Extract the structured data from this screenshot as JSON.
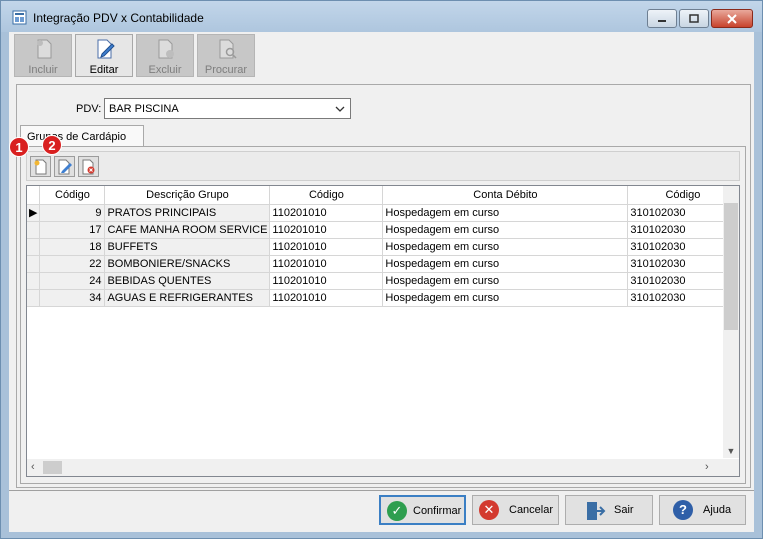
{
  "window": {
    "title": "Integração PDV x Contabilidade"
  },
  "toolbar": {
    "incluir": "Incluir",
    "editar": "Editar",
    "excluir": "Excluir",
    "procurar": "Procurar"
  },
  "pdv": {
    "label": "PDV:",
    "value": "BAR PISCINA"
  },
  "tab": {
    "label": "Grupos de Cardápio"
  },
  "badges": [
    "1",
    "2"
  ],
  "grid": {
    "columns": [
      "Código",
      "Descrição Grupo",
      "Código",
      "Conta Débito",
      "Código"
    ],
    "rows": [
      {
        "codigo": "9",
        "descricao": "PRATOS PRINCIPAIS",
        "cod_debito": "110201010",
        "conta_debito": "Hospedagem em curso",
        "cod_credito": "310102030"
      },
      {
        "codigo": "17",
        "descricao": "CAFE MANHA ROOM SERVICE",
        "cod_debito": "110201010",
        "conta_debito": "Hospedagem em curso",
        "cod_credito": "310102030"
      },
      {
        "codigo": "18",
        "descricao": "BUFFETS",
        "cod_debito": "110201010",
        "conta_debito": "Hospedagem em curso",
        "cod_credito": "310102030"
      },
      {
        "codigo": "22",
        "descricao": "BOMBONIERE/SNACKS",
        "cod_debito": "110201010",
        "conta_debito": "Hospedagem em curso",
        "cod_credito": "310102030"
      },
      {
        "codigo": "24",
        "descricao": "BEBIDAS QUENTES",
        "cod_debito": "110201010",
        "conta_debito": "Hospedagem em curso",
        "cod_credito": "310102030"
      },
      {
        "codigo": "34",
        "descricao": "AGUAS E REFRIGERANTES",
        "cod_debito": "110201010",
        "conta_debito": "Hospedagem em curso",
        "cod_credito": "310102030"
      }
    ]
  },
  "buttons": {
    "confirmar": "Confirmar",
    "cancelar": "Cancelar",
    "sair": "Sair",
    "ajuda": "Ajuda"
  },
  "colors": {
    "confirm": "#2e9e4f",
    "cancel": "#d33a2f",
    "help": "#2f5fa8",
    "badge": "#d92020"
  }
}
